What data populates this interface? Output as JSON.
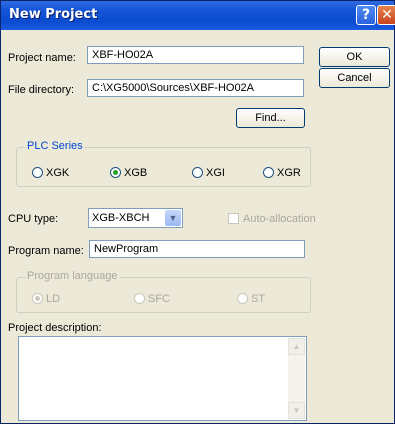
{
  "window": {
    "title": "New Project"
  },
  "titlebar": {
    "help_glyph": "?",
    "close_glyph": "✕"
  },
  "fields": {
    "project_name_label": "Project name:",
    "project_name_value": "XBF-HO02A",
    "file_directory_label": "File directory:",
    "file_directory_value": "C:\\XG5000\\Sources\\XBF-HO02A",
    "find_button": "Find..."
  },
  "buttons": {
    "ok": "OK",
    "cancel": "Cancel"
  },
  "plc_series": {
    "title": "PLC Series",
    "options": [
      "XGK",
      "XGB",
      "XGI",
      "XGR"
    ],
    "selected": "XGB"
  },
  "cpu": {
    "label": "CPU type:",
    "value": "XGB-XBCH",
    "auto_allocation": "Auto-allocation"
  },
  "program": {
    "label": "Program name:",
    "value": "NewProgram"
  },
  "program_language": {
    "title": "Program language",
    "options": [
      "LD",
      "SFC",
      "ST"
    ],
    "selected": "LD"
  },
  "description": {
    "label": "Project description:",
    "value": ""
  },
  "icons": {
    "combo_arrow": "▼",
    "scroll_up": "▲",
    "scroll_down": "▼"
  }
}
